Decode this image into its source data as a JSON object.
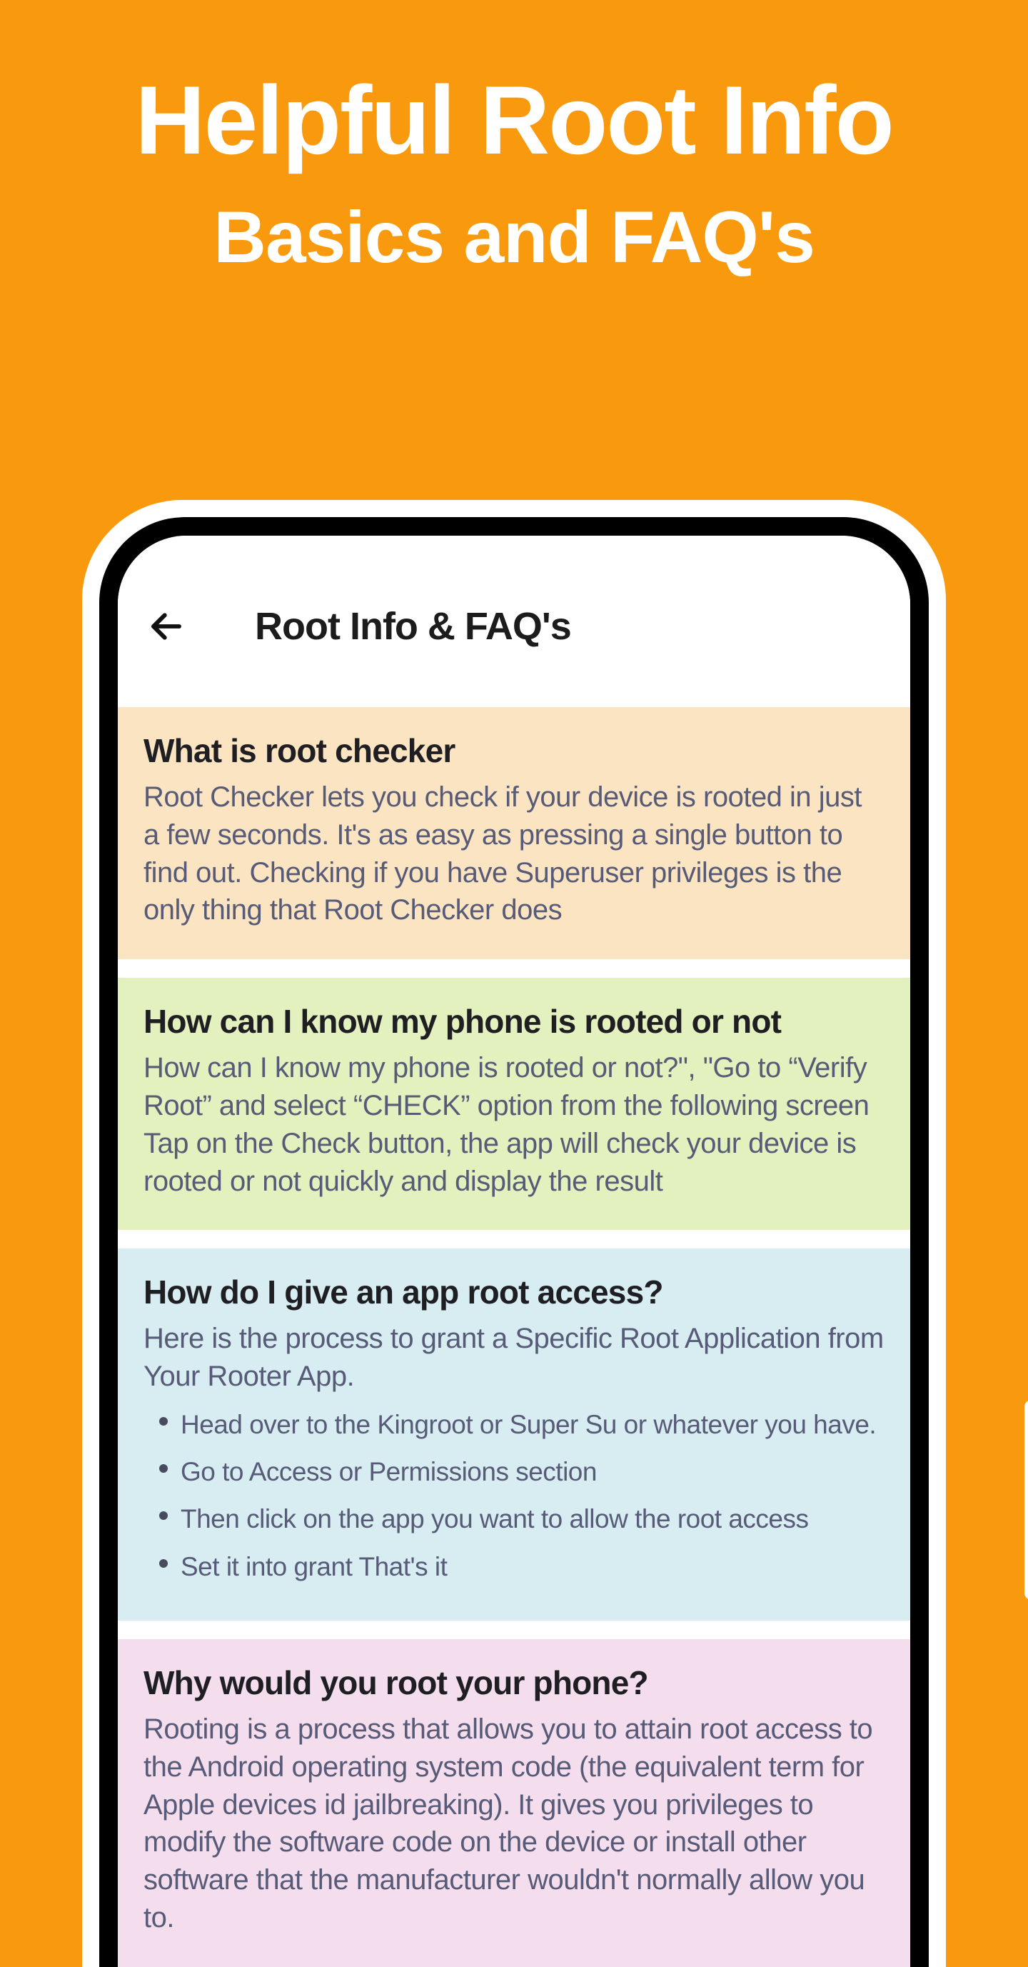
{
  "hero": {
    "title": "Helpful Root Info",
    "subtitle": "Basics and FAQ's"
  },
  "header": {
    "title": "Root Info & FAQ's"
  },
  "faqs": [
    {
      "title": "What is root checker",
      "body": "Root Checker lets you check if your device is rooted in just a few seconds. It's as easy as pressing a single button to find out. Checking if you have Superuser privileges is the only thing that Root Checker does"
    },
    {
      "title": "How can I know my phone is rooted or not",
      "body": "How can I know my phone is rooted or not?\", \"Go to “Verify Root” and select “CHECK” option from the following screen Tap on the Check button, the app will check your device is rooted or not quickly and display the result"
    },
    {
      "title": "How do I give an app root access?",
      "intro": "Here is the process to grant a Specific Root Application from Your Rooter App.",
      "items": [
        "Head over to the Kingroot or Super Su or whatever you have.",
        "Go to Access or Permissions section",
        "Then click on the app you want to allow the root access",
        "Set it into grant That's it"
      ]
    },
    {
      "title": "Why would you root your phone?",
      "body": "Rooting is a process that allows you to attain root access to the Android operating system code (the equivalent term for Apple devices id jailbreaking). It gives you privileges to modify the software code on the device or install other software that the manufacturer wouldn't normally allow you to."
    }
  ]
}
